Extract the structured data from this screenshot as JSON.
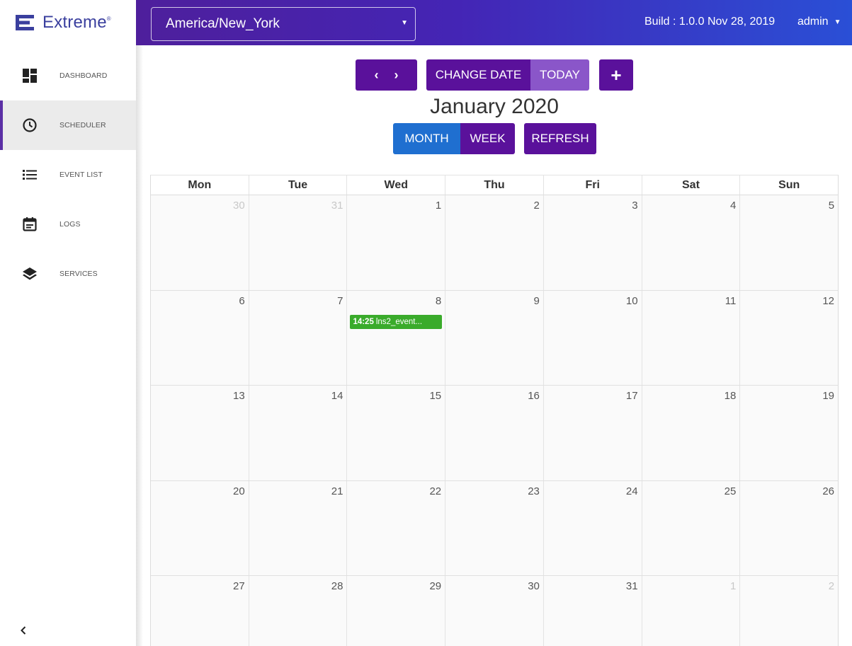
{
  "brand": {
    "name": "Extreme",
    "mark": "®"
  },
  "sidebar": {
    "items": [
      {
        "label": "DASHBOARD",
        "icon": "dashboard-icon",
        "active": false
      },
      {
        "label": "SCHEDULER",
        "icon": "clock-icon",
        "active": true
      },
      {
        "label": "EVENT LIST",
        "icon": "list-icon",
        "active": false
      },
      {
        "label": "LOGS",
        "icon": "calendar-icon",
        "active": false
      },
      {
        "label": "SERVICES",
        "icon": "layers-icon",
        "active": false
      }
    ],
    "collapse_label": "‹"
  },
  "topbar": {
    "timezone": "America/New_York",
    "build": "Build : 1.0.0 Nov 28, 2019",
    "user": "admin"
  },
  "toolbar": {
    "prev": "‹",
    "next": "›",
    "change_date": "CHANGE DATE",
    "today": "TODAY",
    "add": "+",
    "month": "MONTH",
    "week": "WEEK",
    "refresh": "REFRESH"
  },
  "calendar": {
    "title": "January 2020",
    "weekdays": [
      "Mon",
      "Tue",
      "Wed",
      "Thu",
      "Fri",
      "Sat",
      "Sun"
    ],
    "weeks": [
      [
        {
          "day": "30",
          "muted": true
        },
        {
          "day": "31",
          "muted": true
        },
        {
          "day": "1"
        },
        {
          "day": "2"
        },
        {
          "day": "3"
        },
        {
          "day": "4"
        },
        {
          "day": "5"
        }
      ],
      [
        {
          "day": "6"
        },
        {
          "day": "7"
        },
        {
          "day": "8",
          "event": {
            "time": "14:25",
            "title": "lns2_event..."
          }
        },
        {
          "day": "9"
        },
        {
          "day": "10"
        },
        {
          "day": "11"
        },
        {
          "day": "12"
        }
      ],
      [
        {
          "day": "13"
        },
        {
          "day": "14"
        },
        {
          "day": "15"
        },
        {
          "day": "16"
        },
        {
          "day": "17"
        },
        {
          "day": "18"
        },
        {
          "day": "19"
        }
      ],
      [
        {
          "day": "20"
        },
        {
          "day": "21"
        },
        {
          "day": "22"
        },
        {
          "day": "23"
        },
        {
          "day": "24"
        },
        {
          "day": "25"
        },
        {
          "day": "26"
        }
      ],
      [
        {
          "day": "27"
        },
        {
          "day": "28"
        },
        {
          "day": "29"
        },
        {
          "day": "30"
        },
        {
          "day": "31"
        },
        {
          "day": "1",
          "muted": true
        },
        {
          "day": "2",
          "muted": true
        }
      ]
    ]
  },
  "colors": {
    "accent": "#5a119b",
    "today_button": "#8a56c9",
    "month_button": "#1f6fd0",
    "event": "#3aab2b",
    "brand": "#3a3f9e"
  }
}
